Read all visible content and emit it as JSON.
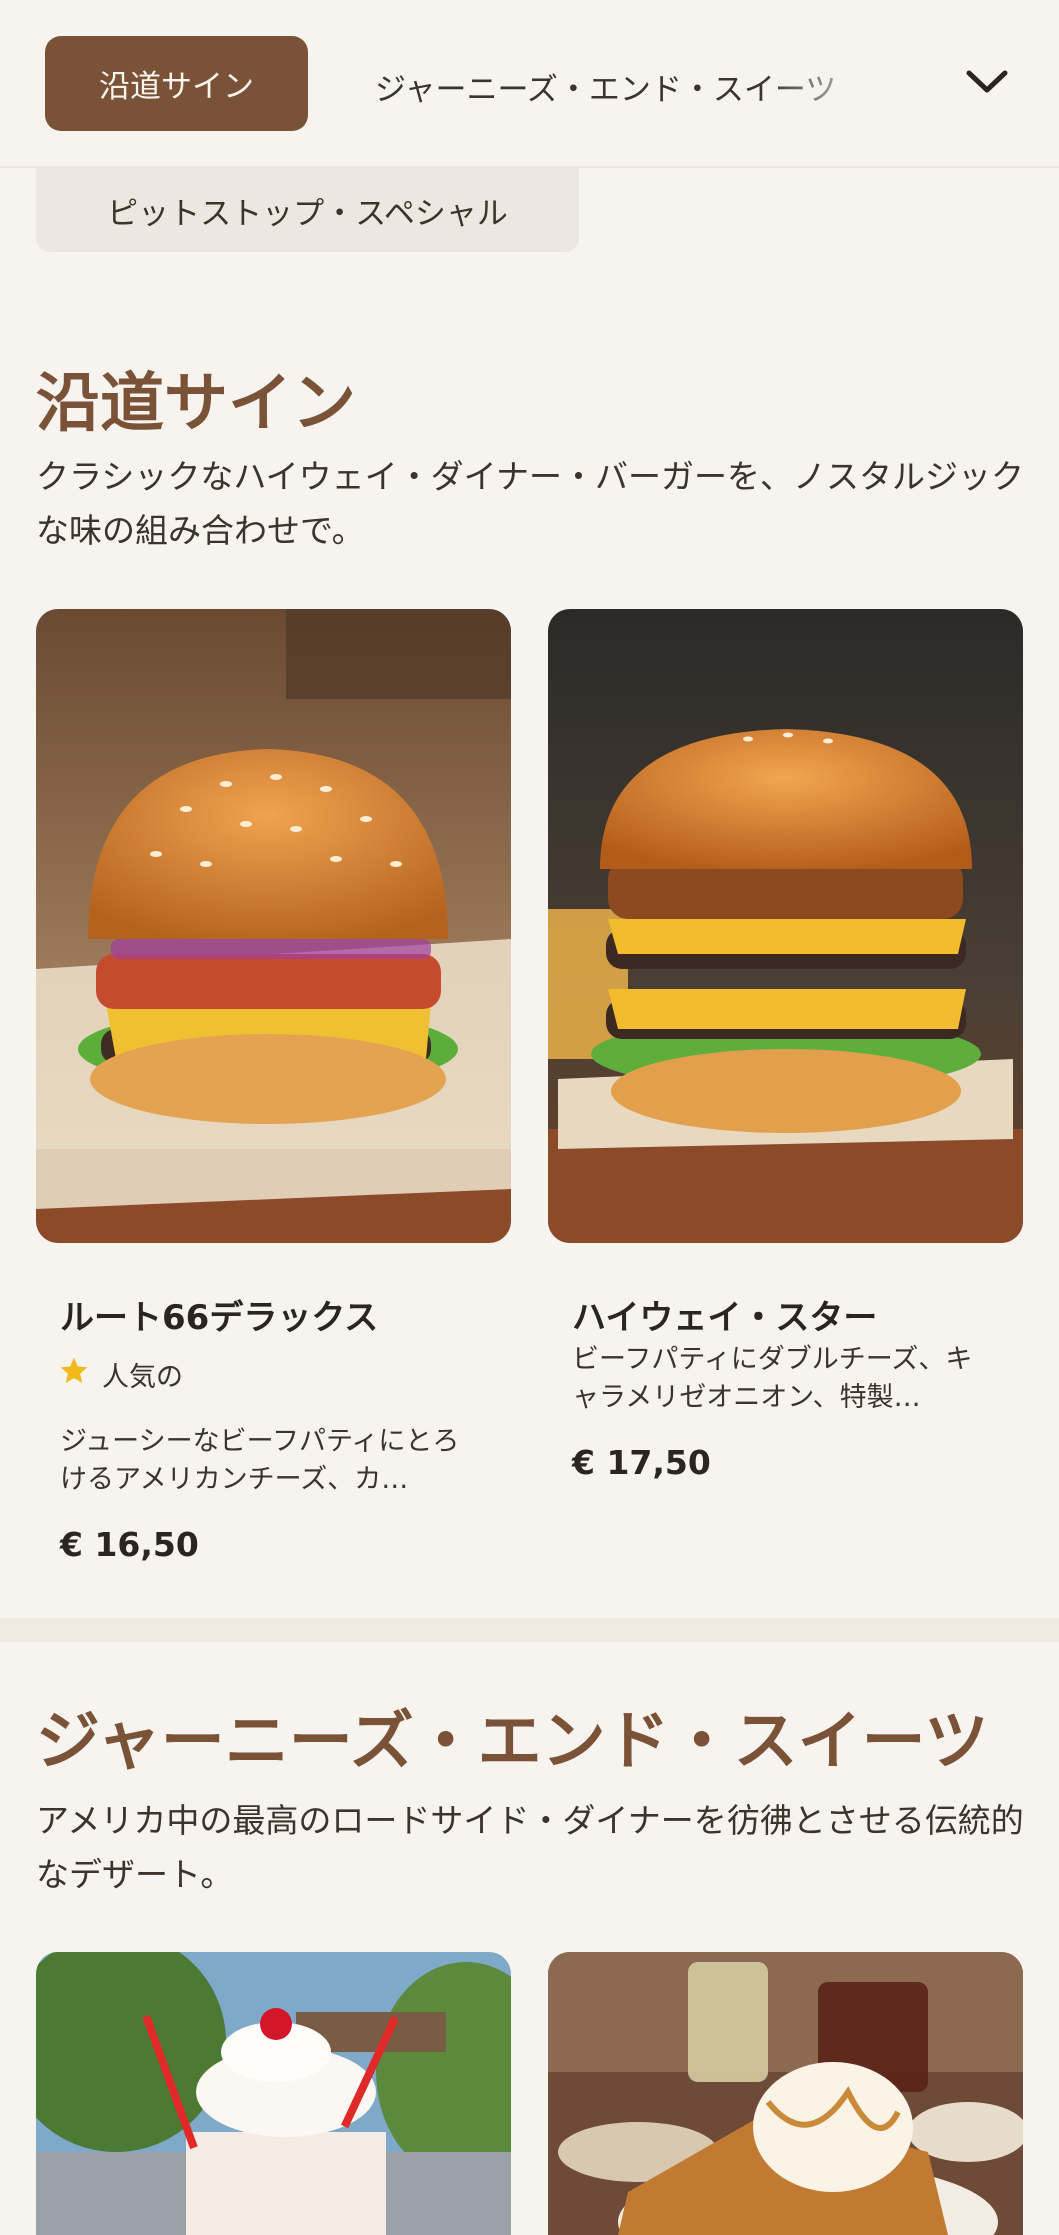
{
  "nav": {
    "active_label": "沿道サイン",
    "next_label": "ジャーニーズ・エンド・スイーツ",
    "sub_label": "ピットストップ・スペシャル"
  },
  "sections": [
    {
      "title": "沿道サイン",
      "description": "クラシックなハイウェイ・ダイナー・バーガーを、ノスタルジックな味の組み合わせで。",
      "items": [
        {
          "name": "ルート66デラックス",
          "badge": "人気の",
          "description": "ジューシーなビーフパティにとろけるアメリカンチーズ、カ…",
          "price": "€ 16,50",
          "image_icon": "burger-photo"
        },
        {
          "name": "ハイウェイ・スター",
          "description": "ビーフパティにダブルチーズ、キャラメリゼオニオン、特製…",
          "price": "€ 17,50",
          "image_icon": "double-burger-photo"
        }
      ]
    },
    {
      "title": "ジャーニーズ・エンド・スイーツ",
      "description": "アメリカ中の最高のロードサイド・ダイナーを彷彿とさせる伝統的なデザート。",
      "items": [
        {
          "image_icon": "milkshake-photo"
        },
        {
          "image_icon": "dessert-photo"
        }
      ]
    }
  ],
  "colors": {
    "accent": "#7a5237",
    "background": "#f7f3ee",
    "star": "#f2b81c"
  },
  "icons": {
    "dropdown": "chevron-down-icon",
    "popular": "star-icon"
  }
}
